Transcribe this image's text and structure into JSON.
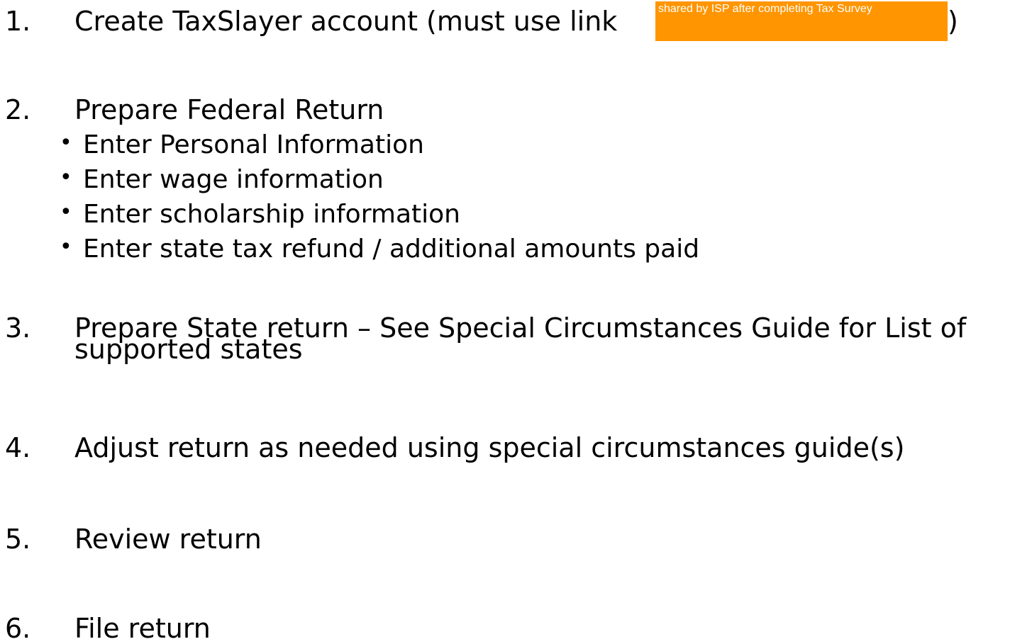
{
  "steps": [
    {
      "number": "1.",
      "text": "Create TaxSlayer account (must use link",
      "link_note": "shared by ISP after completing Tax Survey",
      "closing": ")"
    },
    {
      "number": "2.",
      "text": "Prepare Federal Return"
    },
    {
      "number": "3.",
      "text": "Prepare State return – See Special Circumstances Guide for List of",
      "continuation": "supported states"
    },
    {
      "number": "4.",
      "text": "Adjust return as needed using special circumstances guide(s)"
    },
    {
      "number": "5.",
      "text": "Review return"
    },
    {
      "number": "6.",
      "text": "File return"
    }
  ],
  "federal_substeps": [
    "Enter Personal Information",
    "Enter wage information",
    "Enter scholarship information",
    "Enter state tax refund / additional amounts paid"
  ],
  "bullet_glyph": "•",
  "colors": {
    "link_note_background": "#ff9500",
    "link_note_text": "#ffffff",
    "text": "#000000"
  }
}
